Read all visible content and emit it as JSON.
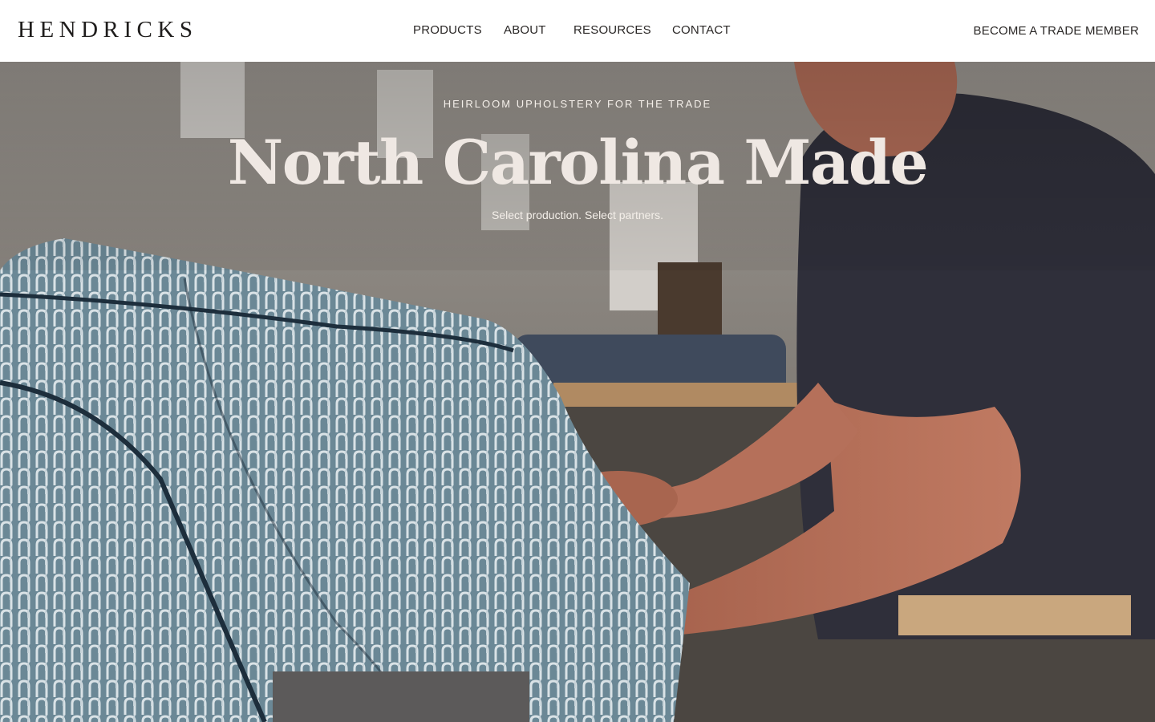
{
  "brand": {
    "logo_text": "HENDRICKS"
  },
  "nav": {
    "items": [
      {
        "label": "PRODUCTS"
      },
      {
        "label": "ABOUT"
      },
      {
        "label": "RESOURCES"
      },
      {
        "label": "CONTACT"
      }
    ],
    "cta_label": "BECOME A TRADE MEMBER"
  },
  "hero": {
    "eyebrow": "HEIRLOOM UPHOLSTERY FOR THE TRADE",
    "title": "North Carolina Made",
    "subtitle": "Select production. Select partners."
  },
  "colors": {
    "header_bg": "#ffffff",
    "text_dark": "#1f1d1c",
    "hero_text": "#efe8e3",
    "fabric_blue": "#5f7d8c",
    "shirt_navy": "#2f2f3a",
    "skin": "#b0705a"
  }
}
